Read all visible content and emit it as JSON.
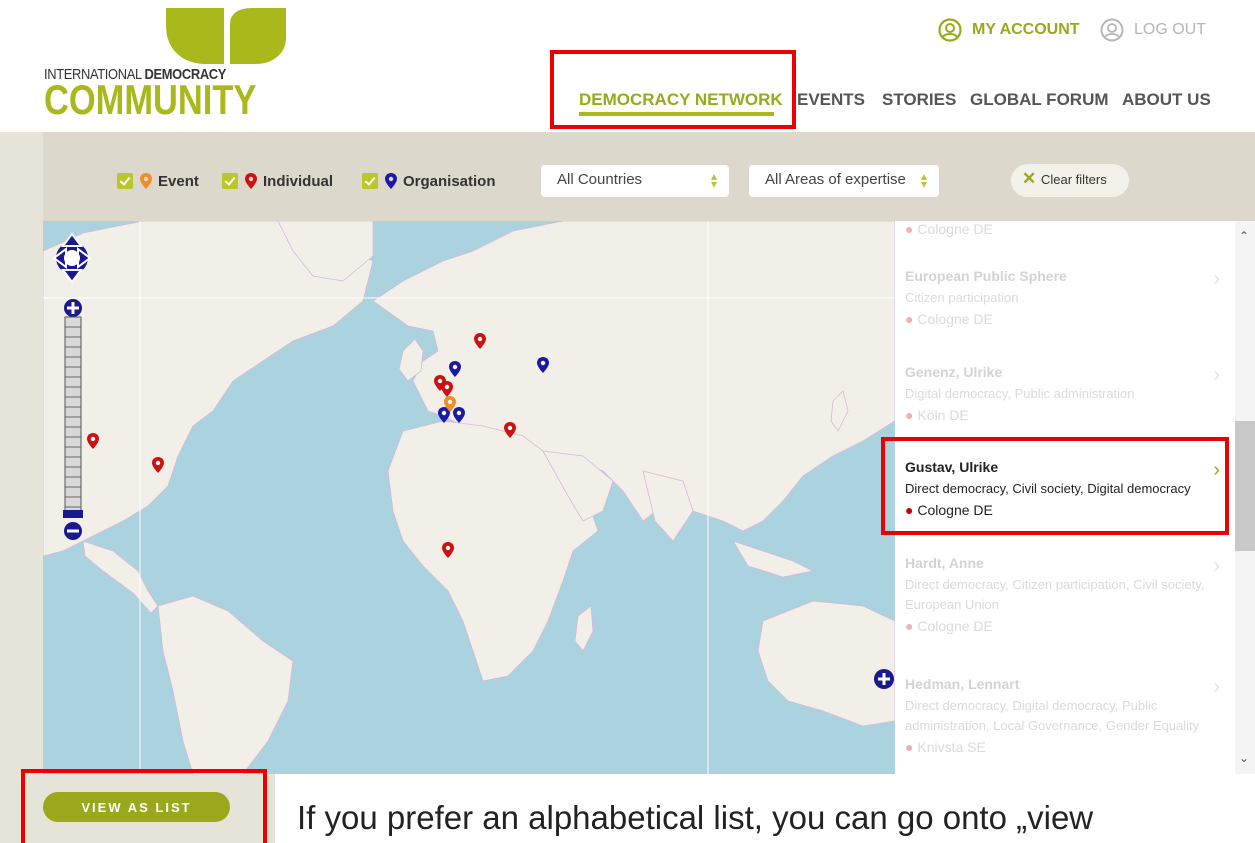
{
  "header": {
    "logo_line1_regular": "INTERNATIONAL ",
    "logo_line1_bold": "DEMOCRACY",
    "logo_line2": "COMMUNITY",
    "my_account_label": "MY ACCOUNT",
    "logout_label": "LOG OUT",
    "nav": [
      "DEMOCRACY NETWORK",
      "EVENTS",
      "STORIES",
      "GLOBAL FORUM",
      "ABOUT US"
    ],
    "nav_active": "DEMOCRACY NETWORK"
  },
  "filters": {
    "types": [
      {
        "label": "Event",
        "checked": true,
        "pin_color": "#f28c28"
      },
      {
        "label": "Individual",
        "checked": true,
        "pin_color": "#cc1111"
      },
      {
        "label": "Organisation",
        "checked": true,
        "pin_color": "#1a1aa6"
      }
    ],
    "country_select": "All Countries",
    "expertise_select": "All Areas of expertise",
    "clear_label": "Clear filters"
  },
  "list": {
    "entries": [
      {
        "name": "",
        "tags": "",
        "location": "Cologne DE",
        "active": false
      },
      {
        "name": "European Public Sphere",
        "tags": "Citizen participation",
        "location": "Cologne DE",
        "active": false
      },
      {
        "name": "Genenz, Ulrike",
        "tags": "Digital democracy, Public administration",
        "location": "Köln DE",
        "active": false
      },
      {
        "name": "Gustav, Ulrike",
        "tags": "Direct democracy, Civil society, Digital democracy",
        "location": "Cologne DE",
        "active": true
      },
      {
        "name": "Hardt, Anne",
        "tags": "Direct democracy, Citizen participation, Civil society, European Union",
        "location": "Cologne DE",
        "active": false
      },
      {
        "name": "Hedman, Lennart",
        "tags": "Direct democracy, Digital democracy, Public administration, Local Governance, Gender Equality",
        "location": "Knivsta SE",
        "active": false
      }
    ]
  },
  "map": {
    "colors": {
      "water": "#aad3df",
      "land": "#f2efe9",
      "border": "#c9a0c9",
      "individual": "#cc1111",
      "organisation": "#1a1aa6",
      "event": "#f28c28"
    }
  },
  "bottom": {
    "view_as_list": "VIEW AS LIST",
    "caption": "If you prefer an alphabetical list, you can go onto „view"
  }
}
